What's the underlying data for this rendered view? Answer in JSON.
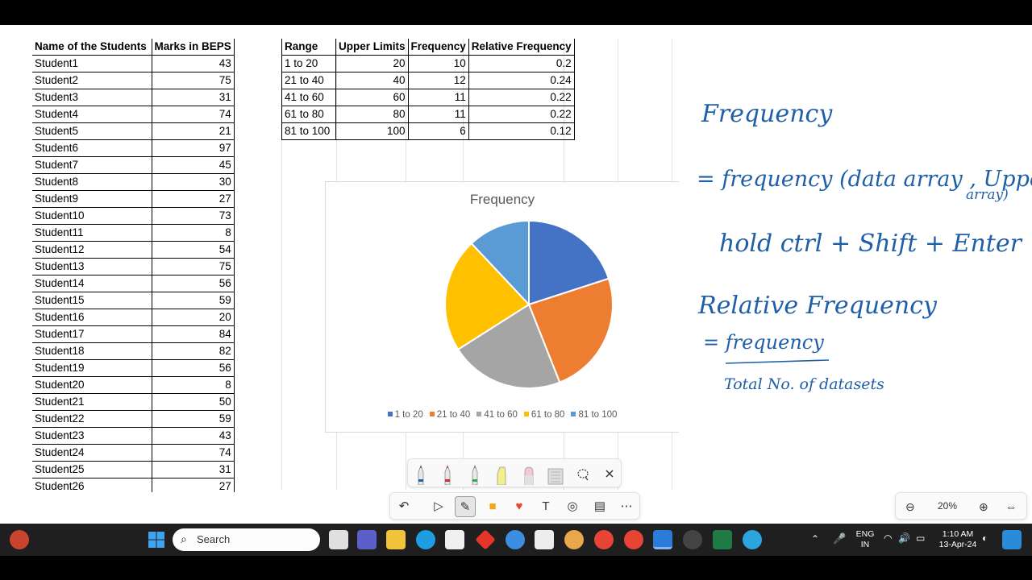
{
  "students_table": {
    "headers": [
      "Name of the Students",
      "Marks in BEPS"
    ],
    "rows": [
      [
        "Student1",
        "43"
      ],
      [
        "Student2",
        "75"
      ],
      [
        "Student3",
        "31"
      ],
      [
        "Student4",
        "74"
      ],
      [
        "Student5",
        "21"
      ],
      [
        "Student6",
        "97"
      ],
      [
        "Student7",
        "45"
      ],
      [
        "Student8",
        "30"
      ],
      [
        "Student9",
        "27"
      ],
      [
        "Student10",
        "73"
      ],
      [
        "Student11",
        "8"
      ],
      [
        "Student12",
        "54"
      ],
      [
        "Student13",
        "75"
      ],
      [
        "Student14",
        "56"
      ],
      [
        "Student15",
        "59"
      ],
      [
        "Student16",
        "20"
      ],
      [
        "Student17",
        "84"
      ],
      [
        "Student18",
        "82"
      ],
      [
        "Student19",
        "56"
      ],
      [
        "Student20",
        "8"
      ],
      [
        "Student21",
        "50"
      ],
      [
        "Student22",
        "59"
      ],
      [
        "Student23",
        "43"
      ],
      [
        "Student24",
        "74"
      ],
      [
        "Student25",
        "31"
      ],
      [
        "Student26",
        "27"
      ]
    ]
  },
  "frequency_table": {
    "headers": [
      "Range",
      "Upper Limits",
      "Frequency",
      "Relative Frequency"
    ],
    "rows": [
      [
        "1 to 20",
        "20",
        "10",
        "0.2"
      ],
      [
        "21 to 40",
        "40",
        "12",
        "0.24"
      ],
      [
        "41 to 60",
        "60",
        "11",
        "0.22"
      ],
      [
        "61 to 80",
        "80",
        "11",
        "0.22"
      ],
      [
        "81 to 100",
        "100",
        "6",
        "0.12"
      ]
    ]
  },
  "chart_data": {
    "type": "pie",
    "title": "Frequency",
    "categories": [
      "1 to 20",
      "21 to 40",
      "41 to 60",
      "61 to 80",
      "81 to 100"
    ],
    "values": [
      10,
      12,
      11,
      11,
      6
    ],
    "colors": [
      "#4472c4",
      "#ed7d31",
      "#a5a5a5",
      "#ffc000",
      "#5b9bd5"
    ],
    "legend_position": "bottom"
  },
  "notes": {
    "line1": "Frequency",
    "line2": "= frequency (data array , Upper limit",
    "line2b": "array)",
    "line3": "hold ctrl + Shift + Enter",
    "line4": "Relative Frequency",
    "line5": "= frequency",
    "line6": "Total No. of datasets",
    "ink_color": "#1f5fa8"
  },
  "ink_toolbar": {
    "zoom": "20%"
  },
  "taskbar": {
    "search_placeholder": "Search",
    "language": "ENG",
    "region": "IN",
    "time": "1:10 AM",
    "date": "13-Apr-24"
  }
}
